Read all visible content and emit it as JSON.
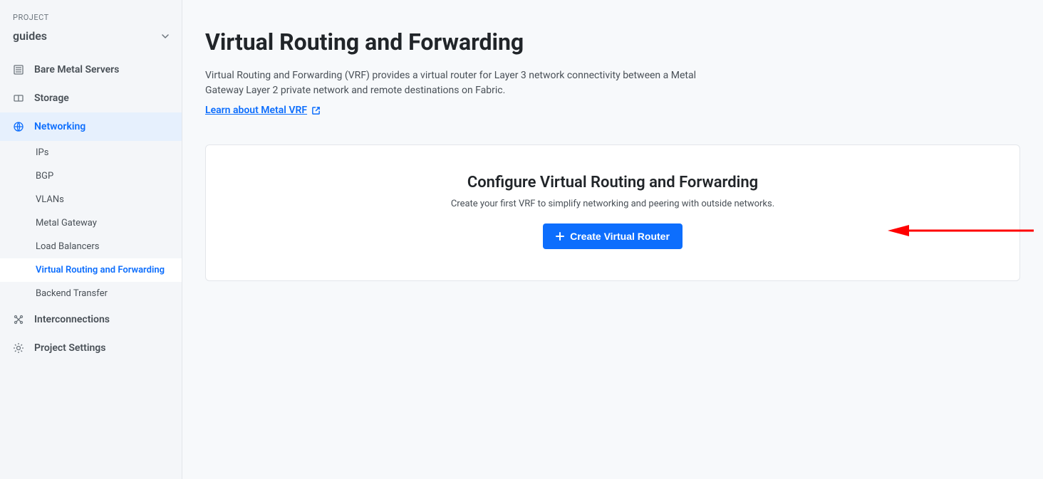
{
  "sidebar": {
    "header_label": "PROJECT",
    "project_name": "guides",
    "items": [
      {
        "label": "Bare Metal Servers"
      },
      {
        "label": "Storage"
      },
      {
        "label": "Networking"
      },
      {
        "label": "Interconnections"
      },
      {
        "label": "Project Settings"
      }
    ],
    "networking_subitems": [
      {
        "label": "IPs"
      },
      {
        "label": "BGP"
      },
      {
        "label": "VLANs"
      },
      {
        "label": "Metal Gateway"
      },
      {
        "label": "Load Balancers"
      },
      {
        "label": "Virtual Routing and Forwarding"
      },
      {
        "label": "Backend Transfer"
      }
    ]
  },
  "main": {
    "title": "Virtual Routing and Forwarding",
    "description": "Virtual Routing and Forwarding (VRF) provides a virtual router for Layer 3 network connectivity between a Metal Gateway Layer 2 private network and remote destinations on Fabric.",
    "learn_link": "Learn about Metal VRF",
    "card": {
      "title": "Configure Virtual Routing and Forwarding",
      "subtitle": "Create your first VRF to simplify networking and peering with outside networks.",
      "button_label": "Create Virtual Router"
    }
  }
}
